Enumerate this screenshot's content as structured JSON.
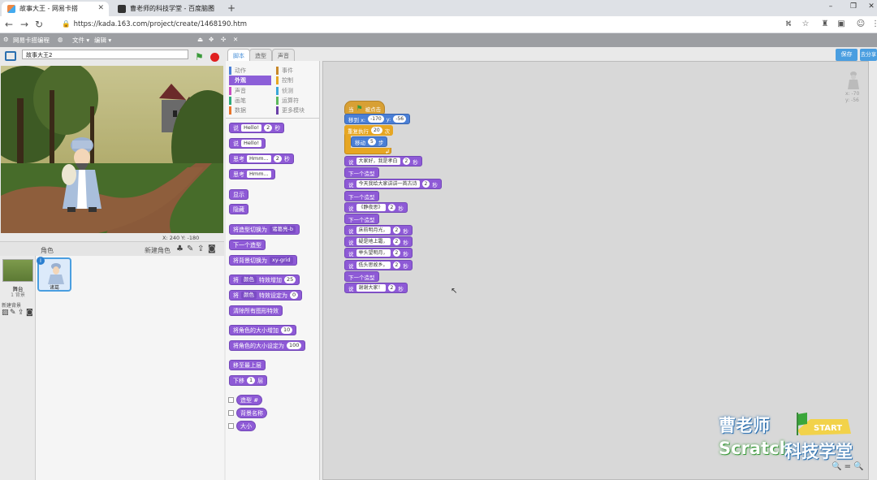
{
  "browser": {
    "tabs": [
      {
        "title": "故事大王 - 网易卡搭",
        "active": true
      },
      {
        "title": "曹老师的科技学堂 - 百度脑图",
        "active": false
      }
    ],
    "new_tab": "+",
    "url": "https://kada.163.com/project/create/1468190.htm",
    "window_controls": {
      "minimize": "–",
      "restore": "❐",
      "close": "✕"
    }
  },
  "menubar": {
    "brand": "网易卡搭编程",
    "file": "文件 ▾",
    "edit": "编辑 ▾"
  },
  "stage": {
    "project_name": "故事大王2",
    "coords": "X: 240  Y: -180"
  },
  "sprites": {
    "header": "角色",
    "new_sprite": "新建角色",
    "stage_label": "舞台",
    "stage_sub": "1 背景",
    "new_backdrop": "新建背景",
    "sprite_name": "诸葛"
  },
  "palette": {
    "tabs": [
      "脚本",
      "造型",
      "声音"
    ],
    "categories_left": [
      "动作",
      "外观",
      "声音",
      "画笔",
      "数据"
    ],
    "categories_right": [
      "事件",
      "控制",
      "侦测",
      "运算符",
      "更多模块"
    ],
    "cat_colors_left": [
      "#4a7fd6",
      "#8e5ad6",
      "#c94fc0",
      "#2da97a",
      "#e8742a"
    ],
    "cat_colors_right": [
      "#c8882a",
      "#e6a623",
      "#3aa6d8",
      "#5cb85c",
      "#6a3fa8"
    ],
    "blocks": {
      "say_for": "说",
      "say_for_val": "Hello!",
      "say_for_secs": "2",
      "say_for_unit": "秒",
      "say": "说",
      "say_val": "Hello!",
      "think_for": "思考",
      "think_for_val": "Hmm...",
      "think_for_secs": "2",
      "think_for_unit": "秒",
      "think": "思考",
      "think_val": "Hmm...",
      "show": "显示",
      "hide": "隐藏",
      "switch_costume": "将造型切换为",
      "switch_costume_val": "诸葛亮-b",
      "next_costume": "下一个造型",
      "switch_backdrop": "将背景切换为",
      "switch_backdrop_val": "xy-grid",
      "change_effect": "将",
      "change_effect_dd": "颜色",
      "change_effect_mid": "特效增加",
      "change_effect_val": "25",
      "set_effect": "将",
      "set_effect_dd": "颜色",
      "set_effect_mid": "特效设定为",
      "set_effect_val": "0",
      "clear_effects": "清除所有图形特效",
      "change_size": "将角色的大小增加",
      "change_size_val": "10",
      "set_size": "将角色的大小设定为",
      "set_size_val": "100",
      "go_front": "移至最上层",
      "go_back": "下移",
      "go_back_val": "1",
      "go_back_unit": "层",
      "costume_num": "造型 #",
      "backdrop_name": "背景名称",
      "size": "大小"
    }
  },
  "toolbar": {
    "save": "保存",
    "share": "去分享"
  },
  "script": {
    "hat_when": "当",
    "hat_clicked": "被点击",
    "goto": "移到 x:",
    "goto_x": "-170",
    "goto_y_label": "y:",
    "goto_y": "-56",
    "repeat": "重复执行",
    "repeat_val": "20",
    "repeat_unit": "次",
    "move": "移动",
    "move_val": "5",
    "move_unit": "步",
    "next_costume": "下一个造型",
    "say_rows": [
      {
        "text": "大家好，我是孝白",
        "secs": "2"
      },
      {
        "text": "今天我给大家讲讲一首古诗",
        "secs": "2"
      },
      {
        "text": "《静夜思》",
        "secs": "2"
      },
      {
        "text": "床前明月光，",
        "secs": "2"
      },
      {
        "text": "疑是地上霜，",
        "secs": "2"
      },
      {
        "text": "举头望明月，",
        "secs": "2"
      },
      {
        "text": "低头思故乡。",
        "secs": "2"
      },
      {
        "text": "谢谢大家！",
        "secs": "2"
      }
    ],
    "say": "说",
    "secs_unit": "秒",
    "xy_readout": "x: -70\ny: -56"
  },
  "watermark": {
    "line1": "曹老师",
    "scratch": "Scratch",
    "line2": "科技学堂",
    "flag_text": "START"
  },
  "zoom": "🔍 = 🔍"
}
